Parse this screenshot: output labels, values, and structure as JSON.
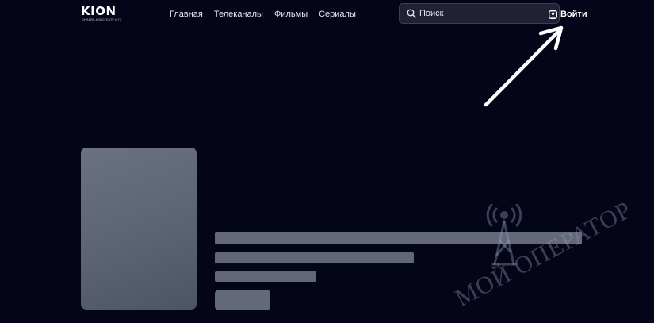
{
  "header": {
    "logo": {
      "wordmark": "KION",
      "tagline": "ОНЛАЙН-КИНОТЕАТР МТС"
    },
    "nav": [
      {
        "label": "Главная",
        "name": "nav-home"
      },
      {
        "label": "Телеканалы",
        "name": "nav-tv-channels"
      },
      {
        "label": "Фильмы",
        "name": "nav-movies"
      },
      {
        "label": "Сериалы",
        "name": "nav-series"
      }
    ],
    "search": {
      "placeholder": "Поиск",
      "value": "",
      "icon": "search-icon"
    },
    "login": {
      "label": "Войти",
      "icon": "user-icon"
    }
  },
  "annotation": {
    "arrow_color": "#ffffff",
    "points_to": "login-button"
  },
  "watermark": {
    "text": "МОЙ ОПЕРАТОР",
    "icon": "radio-tower-icon"
  },
  "colors": {
    "background": "#05051a",
    "skeleton": "#6b7282",
    "search_bg": "#1e2232"
  }
}
